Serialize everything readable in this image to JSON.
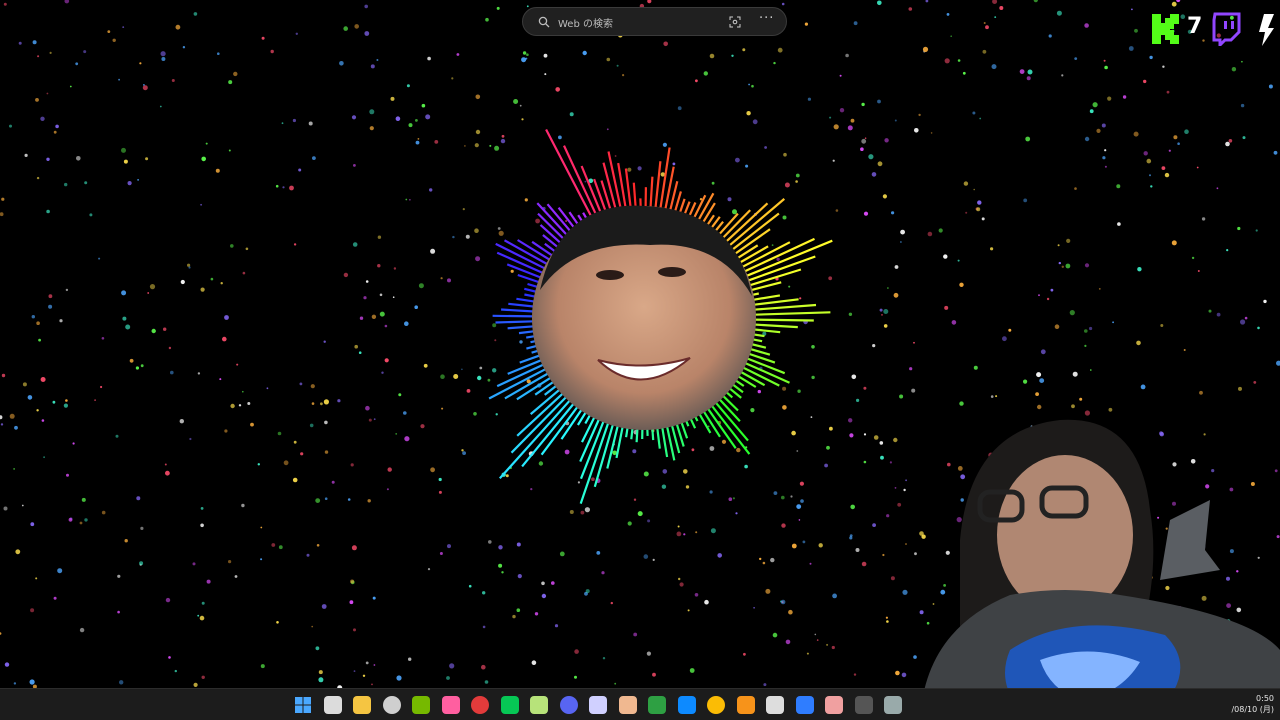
{
  "search": {
    "placeholder": "Web の検索",
    "search_icon": "search-icon",
    "lens_icon": "visual-search-icon",
    "more_icon": "more-icon"
  },
  "overlay": {
    "viewer_count": "7",
    "logos": [
      "kick-logo",
      "twitch-logo",
      "slash-logo"
    ]
  },
  "visualizer": {
    "center_content": "avatar-photo",
    "colors": [
      "#ff2d6f",
      "#ff8a3d",
      "#ffd23d",
      "#6bff3a",
      "#2bf0b0",
      "#3aa8ff",
      "#7a6bff",
      "#d44bff"
    ]
  },
  "taskbar": {
    "icons": [
      "start-icon",
      "task-view-icon",
      "file-explorer-icon",
      "obs-icon",
      "nvidia-icon",
      "lips-icon",
      "record-icon",
      "line-icon",
      "vim-icon",
      "discord-icon",
      "chatgpt-icon",
      "book-icon",
      "xbox-icon",
      "edge-icon",
      "chrome-icon",
      "bitcoin-icon",
      "app-icon",
      "edge-dev-icon",
      "photos-icon",
      "tray-app-icon",
      "tray-app2-icon"
    ],
    "clock_time": "0:50",
    "clock_date": "/08/10 (月)"
  }
}
